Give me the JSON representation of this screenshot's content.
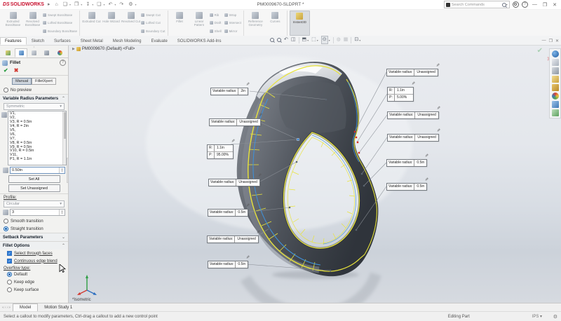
{
  "titlebar": {
    "logo_prefix": "DS",
    "logo": "SOLIDWORKS",
    "title": "PM0009670-SLDPRT *",
    "search_placeholder": "Search Commands"
  },
  "icons": {
    "menu_expand": "▸",
    "home": "⌂",
    "new_document": "❏",
    "open": "❐",
    "save": "↧",
    "print": "❑",
    "undo": "↶",
    "redo": "↷",
    "options": "⚙",
    "minimize": "—",
    "restore": "❐",
    "close": "✕",
    "pm_check": "✔",
    "pm_cancel": "✖",
    "pencil": "✎",
    "caret_down": "▾",
    "chevron_up": "⌃",
    "chevron_down": "⌄",
    "tree_expand": "▶",
    "previous_view": "↶",
    "section_view": "◫",
    "view_orientation": "⬒",
    "display_style": "⬚",
    "hide_show_items": "⊙",
    "edit_appearance": "◍",
    "scene": "▦",
    "view_settings": "⊡",
    "confirm_check": "✔",
    "cancel_x": "✖",
    "spin_up": "▴",
    "spin_down": "▾",
    "nav_first": "«",
    "nav_prev": "‹",
    "nav_next": "›",
    "nav_last": "»"
  },
  "ribbon": {
    "tabs": [
      "Features",
      "Sketch",
      "Surfaces",
      "Sheet Metal",
      "Mesh Modeling",
      "Evaluate",
      "SOLIDWORKS Add-Ins"
    ],
    "active_tab": "Features",
    "buttons": {
      "extruded_boss": "Extruded Boss/Base",
      "revolved_boss": "Revolved Boss/Base",
      "swept_boss": "Swept Boss/Base",
      "lofted_boss": "Lofted Boss/Base",
      "boundary_boss": "Boundary Boss/Base",
      "extruded_cut": "Extruded Cut",
      "hole_wizard": "Hole Wizard",
      "revolved_cut": "Revolved Cut",
      "swept_cut": "Swept Cut",
      "lofted_cut": "Lofted Cut",
      "boundary_cut": "Boundary Cut",
      "fillet": "Fillet",
      "linear_pattern": "Linear Pattern",
      "rib": "Rib",
      "draft": "Draft",
      "shell": "Shell",
      "wrap": "Wrap",
      "intersect": "Intersect",
      "mirror": "Mirror",
      "reference_geometry": "Reference Geometry",
      "curves": "Curves",
      "instant3d": "Instant3D"
    }
  },
  "property_manager": {
    "title": "Fillet",
    "modes": [
      "Manual",
      "FilletXpert"
    ],
    "active_mode": "Manual",
    "no_preview": "No preview",
    "variable_radius": {
      "header": "Variable Radius Parameters",
      "symmetry": "Symmetric",
      "items": [
        "V1,",
        "V2,",
        "V3, R = 0.5in",
        "V4, R = 2in",
        "V5,",
        "V6,",
        "V7,",
        "V8, R = 0.5in",
        "V9, R = 0.5in",
        "V10, R = 0.5in",
        "V11,",
        "P1, R = 1.1in"
      ],
      "radius_value": "0.50in",
      "set_all": "Set All",
      "set_unassigned": "Set Unassigned"
    },
    "profile": {
      "label": "Profile:",
      "type": "Circular",
      "instances": "3",
      "smooth": "Smooth transition",
      "straight": "Straight transition",
      "selected": "Straight transition"
    },
    "setback_header": "Setback Parameters",
    "options": {
      "header": "Fillet Options",
      "select_through_faces": "Select through faces",
      "continuous_edge_blend": "Continuous edge blend",
      "overflow_label": "Overflow type:",
      "overflow_default": "Default",
      "overflow_keep_edge": "Keep edge",
      "overflow_keep_surface": "Keep surface",
      "selected_overflow": "Default"
    }
  },
  "viewport": {
    "tree_node": "PM0009670 (Default) <Full>",
    "view_label": "*Isometric",
    "callout_label": "Variable radius:",
    "callouts": [
      {
        "value": "2in"
      },
      {
        "value": "Unassigned"
      },
      {
        "value": "Unassigned"
      },
      {
        "value": "0.5in"
      },
      {
        "value": "Unassigned"
      },
      {
        "value": "0.5in"
      },
      {
        "value": "Unassigned"
      },
      {
        "value": "Unassigned"
      },
      {
        "value": "Unassigned"
      },
      {
        "value": "0.5in"
      },
      {
        "value": "0.5in"
      }
    ],
    "rp_callouts": [
      {
        "r_label": "R:",
        "r": "1.1in",
        "p_label": "P:",
        "p": "95.00%"
      },
      {
        "r_label": "R:",
        "r": "1.1in",
        "p_label": "P:",
        "p": "5.00%"
      }
    ]
  },
  "bottom": {
    "tabs": [
      "Model",
      "Motion Study 1"
    ],
    "active_tab": "Model",
    "status_message": "Select a callout to modify parameters, Ctrl-drag a callout to add a new control point",
    "mode": "Editing Part",
    "units": "IPS"
  }
}
